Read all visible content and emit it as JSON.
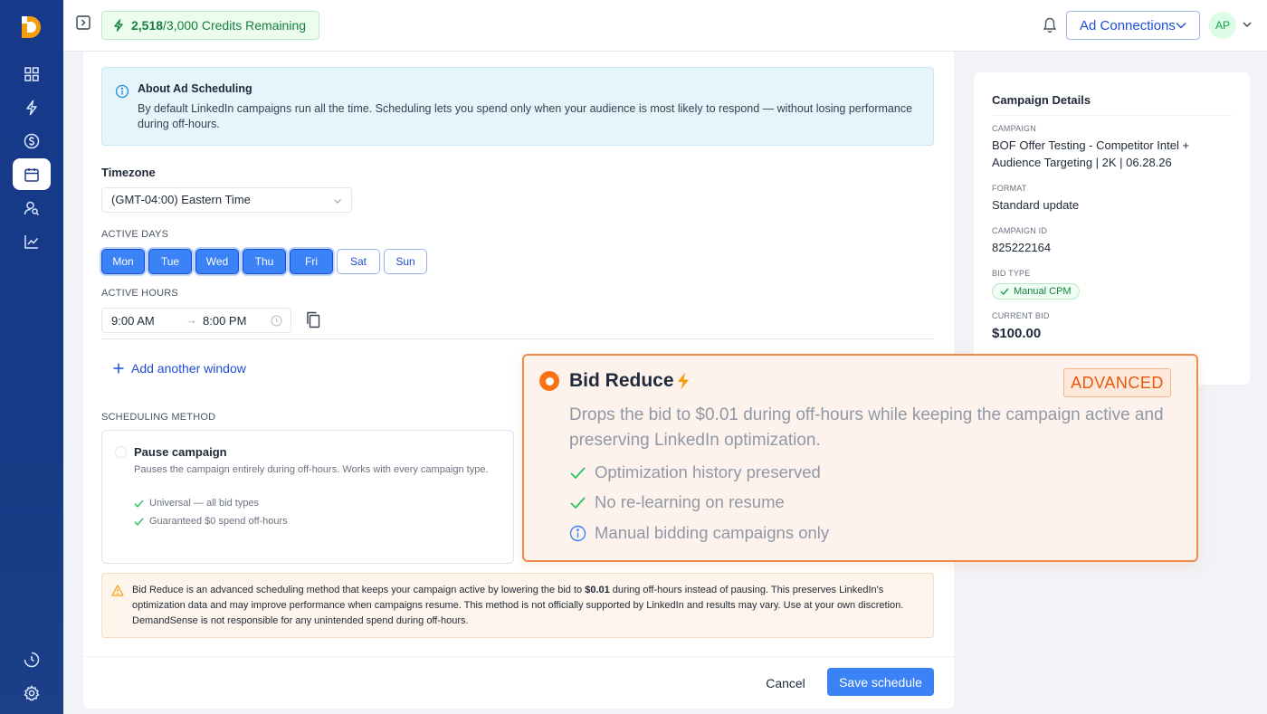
{
  "header": {
    "credits_used": "2,518",
    "credits_total": "/3,000 Credits Remaining",
    "ad_connections_label": "Ad Connections",
    "avatar_initials": "AP"
  },
  "sidebar": {
    "items": [
      {
        "icon": "dashboard-grid-icon",
        "active": false
      },
      {
        "icon": "lightning-icon",
        "active": false
      },
      {
        "icon": "dollar-icon",
        "active": false
      },
      {
        "icon": "calendar-icon",
        "active": true
      },
      {
        "icon": "audience-search-icon",
        "active": false
      },
      {
        "icon": "trend-chart-icon",
        "active": false
      }
    ],
    "bottom_items": [
      {
        "icon": "history-clock-icon"
      },
      {
        "icon": "gear-icon"
      }
    ]
  },
  "about": {
    "title": "About Ad Scheduling",
    "body": "By default LinkedIn campaigns run all the time. Scheduling lets you spend only when your audience is most likely to respond — without losing performance during off-hours."
  },
  "timezone": {
    "label": "Timezone",
    "value": "(GMT-04:00) Eastern Time"
  },
  "active_days": {
    "label": "ACTIVE DAYS",
    "days": [
      {
        "label": "Mon",
        "selected": true
      },
      {
        "label": "Tue",
        "selected": true
      },
      {
        "label": "Wed",
        "selected": true
      },
      {
        "label": "Thu",
        "selected": true
      },
      {
        "label": "Fri",
        "selected": true
      },
      {
        "label": "Sat",
        "selected": false
      },
      {
        "label": "Sun",
        "selected": false
      }
    ]
  },
  "active_hours": {
    "label": "ACTIVE HOURS",
    "start": "9:00 AM",
    "end": "8:00 PM",
    "add_window_label": "Add another window"
  },
  "scheduling_method": {
    "label": "SCHEDULING METHOD",
    "pause": {
      "title": "Pause campaign",
      "description": "Pauses the campaign entirely during off-hours. Works with every campaign type.",
      "features": [
        "Universal — all bid types",
        "Guaranteed $0 spend off-hours"
      ]
    },
    "bid_reduce": {
      "title": "Bid Reduce",
      "badge": "ADVANCED",
      "description": "Drops the bid to $0.01 during off-hours while keeping the campaign active and preserving LinkedIn optimization.",
      "features": [
        {
          "text": "Optimization history preserved",
          "icon": "check-icon"
        },
        {
          "text": "No re-learning on resume",
          "icon": "check-icon"
        },
        {
          "text": "Manual bidding campaigns only",
          "icon": "info-icon"
        }
      ]
    }
  },
  "warning": {
    "before": "Bid Reduce is an advanced scheduling method that keeps your campaign active by lowering the bid to ",
    "amount": "$0.01",
    "after": " during off-hours instead of pausing. This preserves LinkedIn's optimization data and may improve performance when campaigns resume. This method is not officially supported by LinkedIn and results may vary. Use at your own discretion. DemandSense is not responsible for any unintended spend during off-hours."
  },
  "actions": {
    "cancel": "Cancel",
    "save": "Save schedule"
  },
  "details": {
    "title": "Campaign Details",
    "campaign_label": "CAMPAIGN",
    "campaign_value": "BOF Offer Testing - Competitor Intel + Audience Targeting | 2K | 06.28.26",
    "format_label": "FORMAT",
    "format_value": "Standard update",
    "id_label": "CAMPAIGN ID",
    "id_value": "825222164",
    "bid_type_label": "BID TYPE",
    "bid_type_value": "Manual CPM",
    "current_bid_label": "CURRENT BID",
    "current_bid_value": "$100.00"
  },
  "colors": {
    "sidebar": "#173a86",
    "primary": "#3b82f6",
    "accent_orange": "#f97316",
    "success": "#15803d"
  }
}
